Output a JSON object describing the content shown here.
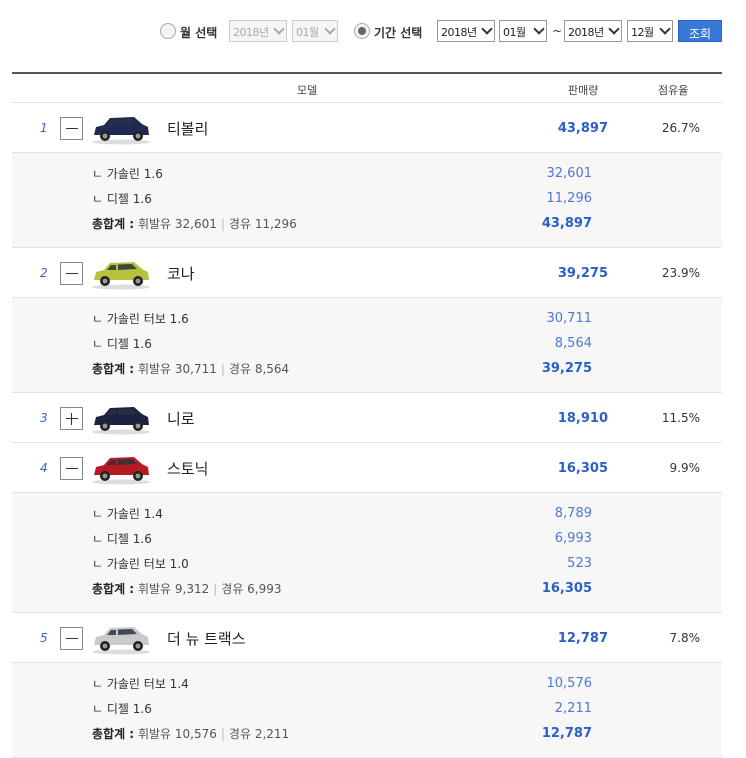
{
  "filter": {
    "month_label": "월 선택",
    "month_year": "2018년",
    "month_month": "01월",
    "period_label": "기간 선택",
    "from_year": "2018년",
    "from_month": "01월",
    "tilde": "~",
    "to_year": "2018년",
    "to_month": "12월",
    "query_label": "조회"
  },
  "table": {
    "headers": {
      "model": "모델",
      "sales": "판매량",
      "share": "점유율"
    },
    "rows": [
      {
        "rank": "1",
        "model": "티볼리",
        "sales": "43,897",
        "share": "26.7%",
        "expanded": true,
        "body_color": "#1e2a55",
        "details": [
          {
            "label": "ㄴ 가솔린 1.6",
            "value": "32,601"
          },
          {
            "label": "ㄴ 디젤 1.6",
            "value": "11,296"
          }
        ],
        "total_label": "총합계 :",
        "total_gas": "휘발유 32,601",
        "total_diesel": "경유 11,296",
        "total_sum": "43,897"
      },
      {
        "rank": "2",
        "model": "코나",
        "sales": "39,275",
        "share": "23.9%",
        "expanded": true,
        "body_color": "#b5c43a",
        "details": [
          {
            "label": "ㄴ 가솔린 터보 1.6",
            "value": "30,711"
          },
          {
            "label": "ㄴ 디젤 1.6",
            "value": "8,564"
          }
        ],
        "total_label": "총합계 :",
        "total_gas": "휘발유 30,711",
        "total_diesel": "경유 8,564",
        "total_sum": "39,275"
      },
      {
        "rank": "3",
        "model": "니로",
        "sales": "18,910",
        "share": "11.5%",
        "expanded": false,
        "body_color": "#1b2340"
      },
      {
        "rank": "4",
        "model": "스토닉",
        "sales": "16,305",
        "share": "9.9%",
        "expanded": true,
        "body_color": "#b51c22",
        "details": [
          {
            "label": "ㄴ 가솔린 1.4",
            "value": "8,789"
          },
          {
            "label": "ㄴ 디젤 1.6",
            "value": "6,993"
          },
          {
            "label": "ㄴ 가솔린 터보 1.0",
            "value": "523"
          }
        ],
        "total_label": "총합계 :",
        "total_gas": "휘발유 9,312",
        "total_diesel": "경유 6,993",
        "total_sum": "16,305"
      },
      {
        "rank": "5",
        "model": "더 뉴 트랙스",
        "sales": "12,787",
        "share": "7.8%",
        "expanded": true,
        "body_color": "#c9cacd",
        "details": [
          {
            "label": "ㄴ 가솔린 터보 1.4",
            "value": "10,576"
          },
          {
            "label": "ㄴ 디젤 1.6",
            "value": "2,211"
          }
        ],
        "total_label": "총합계 :",
        "total_gas": "휘발유 10,576",
        "total_diesel": "경유 2,211",
        "total_sum": "12,787"
      }
    ]
  }
}
